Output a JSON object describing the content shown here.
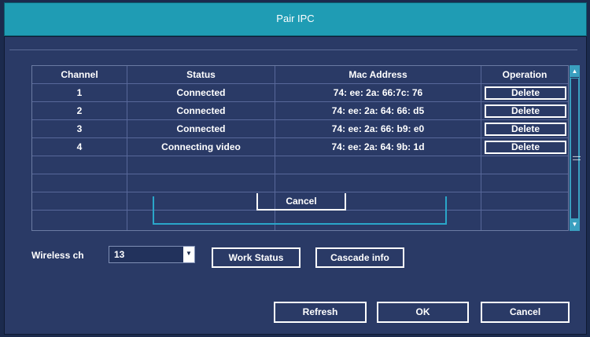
{
  "window": {
    "title": "Pair IPC"
  },
  "table": {
    "columns": [
      "Channel",
      "Status",
      "Mac Address",
      "Operation"
    ],
    "rows": [
      {
        "channel": "1",
        "status": "Connected",
        "mac": "74: ee: 2a: 66:7c: 76",
        "action": "Delete"
      },
      {
        "channel": "2",
        "status": "Connected",
        "mac": "74: ee: 2a: 64: 66: d5",
        "action": "Delete"
      },
      {
        "channel": "3",
        "status": "Connected",
        "mac": "74: ee: 2a: 66: b9: e0",
        "action": "Delete"
      },
      {
        "channel": "4",
        "status": "Connecting video",
        "mac": "74: ee: 2a: 64: 9b: 1d",
        "action": "Delete"
      }
    ],
    "empty_rows": 4,
    "inner_cancel_label": "Cancel"
  },
  "wireless": {
    "label": "Wireless ch",
    "value": "13"
  },
  "buttons": {
    "work_status": "Work Status",
    "cascade_info": "Cascade info",
    "refresh": "Refresh",
    "ok": "OK",
    "cancel": "Cancel"
  },
  "colors": {
    "titlebar": "#1f9cb4",
    "panel": "#2a3a66",
    "accent": "#2aa6c9"
  },
  "icons": {
    "scroll_up": "triangle-up-icon",
    "scroll_down": "triangle-down-icon",
    "dropdown": "triangle-down-icon"
  }
}
